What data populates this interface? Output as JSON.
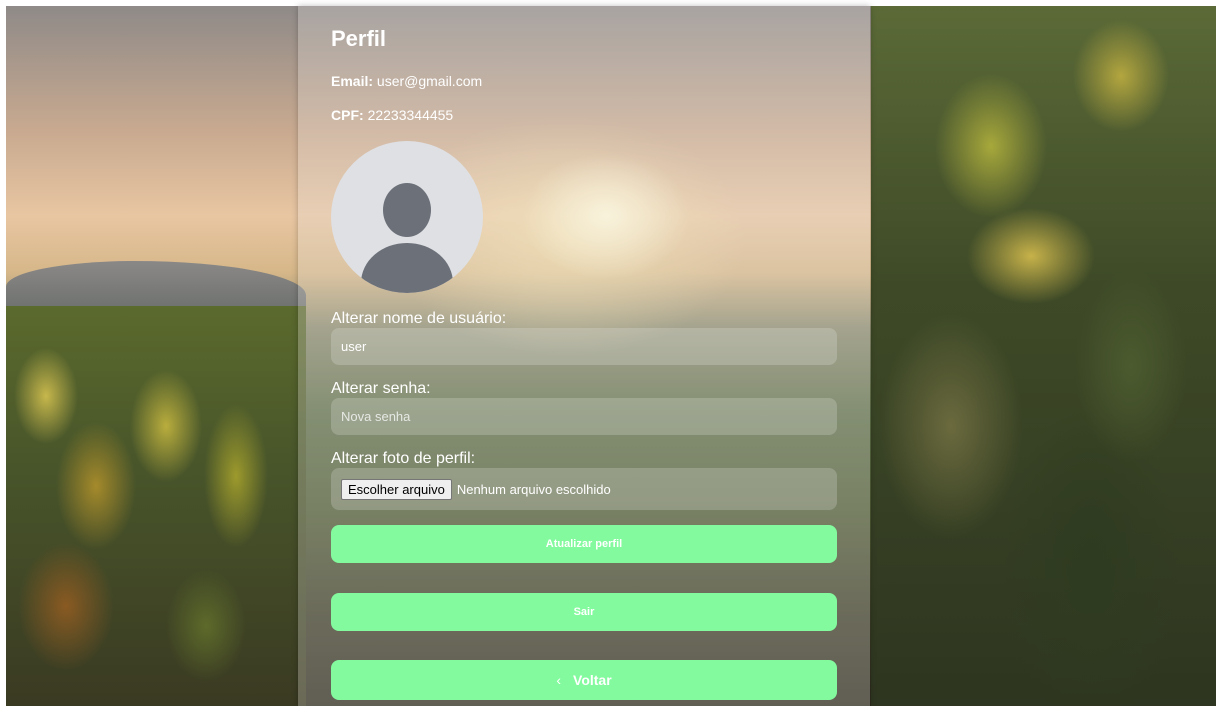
{
  "profile": {
    "title": "Perfil",
    "email_label": "Email:",
    "email_value": "user@gmail.com",
    "cpf_label": "CPF:",
    "cpf_value": "22233344455",
    "avatar_icon": "user-avatar-placeholder-icon"
  },
  "form": {
    "username_label": "Alterar nome de usuário:",
    "username_value": "user",
    "password_label": "Alterar senha:",
    "password_placeholder": "Nova senha",
    "photo_label": "Alterar foto de perfil:",
    "file_button_label": "Escolher arquivo",
    "file_status": "Nenhum arquivo escolhido"
  },
  "actions": {
    "update_label": "Atualizar perfil",
    "exit_label": "Sair",
    "back_icon": "chevron-left-icon",
    "back_label": "Voltar"
  },
  "colors": {
    "button_bg": "#83fa9e",
    "text": "#ffffff"
  }
}
